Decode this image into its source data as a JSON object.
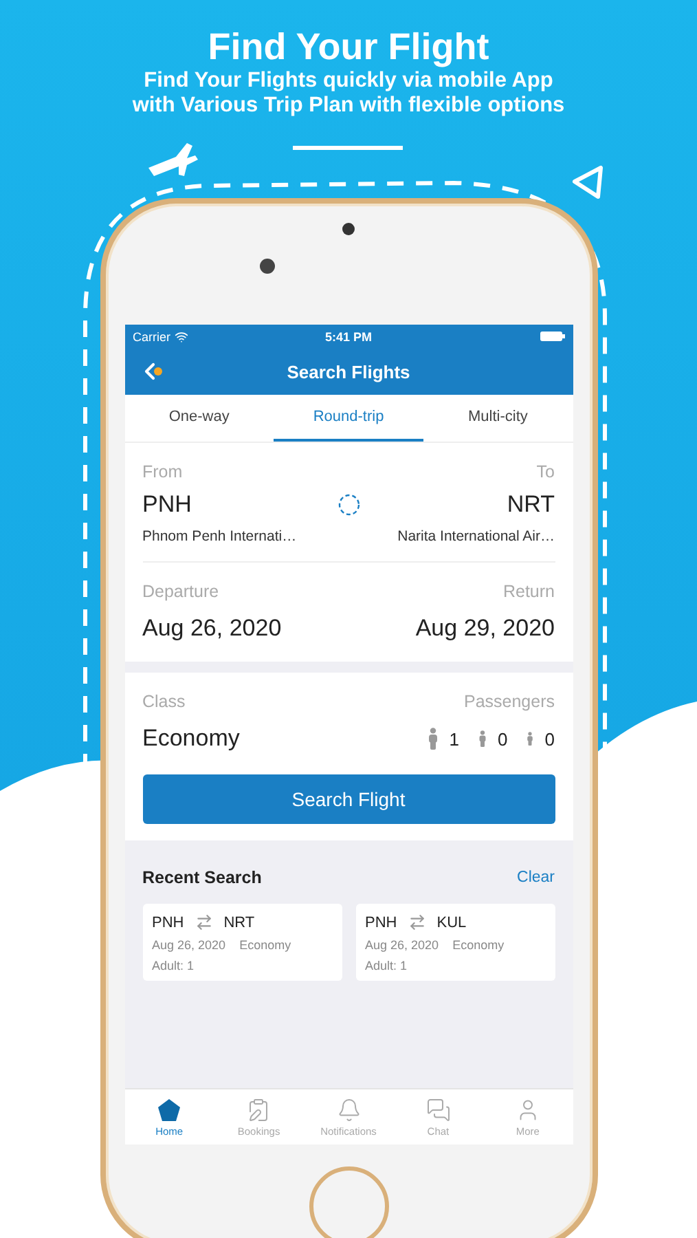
{
  "promo": {
    "title": "Find Your Flight",
    "subtitle": [
      "Find Your Flights quickly via mobile App",
      "with Various Trip Plan with flexible options"
    ]
  },
  "status_bar": {
    "carrier": "Carrier",
    "time": "5:41 PM"
  },
  "nav_bar": {
    "title": "Search Flights"
  },
  "trip_tabs": [
    {
      "label": "One-way",
      "selected": false
    },
    {
      "label": "Round-trip",
      "selected": true
    },
    {
      "label": "Multi-city",
      "selected": false
    }
  ],
  "route": {
    "from_label": "From",
    "to_label": "To",
    "from_code": "PNH",
    "from_name": "Phnom Penh Internati…",
    "to_code": "NRT",
    "to_name": "Narita International Air…"
  },
  "dates": {
    "departure_label": "Departure",
    "departure": "Aug 26, 2020",
    "return_label": "Return",
    "return": "Aug 29, 2020"
  },
  "class": {
    "label": "Class",
    "value": "Economy"
  },
  "passengers": {
    "label": "Passengers",
    "counts": [
      {
        "kind": "adult",
        "count": "1"
      },
      {
        "kind": "child",
        "count": "0"
      },
      {
        "kind": "infant",
        "count": "0"
      }
    ]
  },
  "search_button": "Search Flight",
  "recent": {
    "title": "Recent Search",
    "clear": "Clear",
    "items": [
      {
        "from": "PNH",
        "to": "NRT",
        "date": "Aug 26, 2020",
        "class": "Economy",
        "passengers": "Adult: 1"
      },
      {
        "from": "PNH",
        "to": "KUL",
        "date": "Aug 26, 2020",
        "class": "Economy",
        "passengers": "Adult: 1"
      }
    ]
  },
  "tab_bar": [
    {
      "kind": "home",
      "label": "Home",
      "selected": true
    },
    {
      "kind": "bookings",
      "label": "Bookings",
      "selected": false
    },
    {
      "kind": "notifications",
      "label": "Notifications",
      "selected": false
    },
    {
      "kind": "chat",
      "label": "Chat",
      "selected": false
    },
    {
      "kind": "more",
      "label": "More",
      "selected": false
    }
  ]
}
